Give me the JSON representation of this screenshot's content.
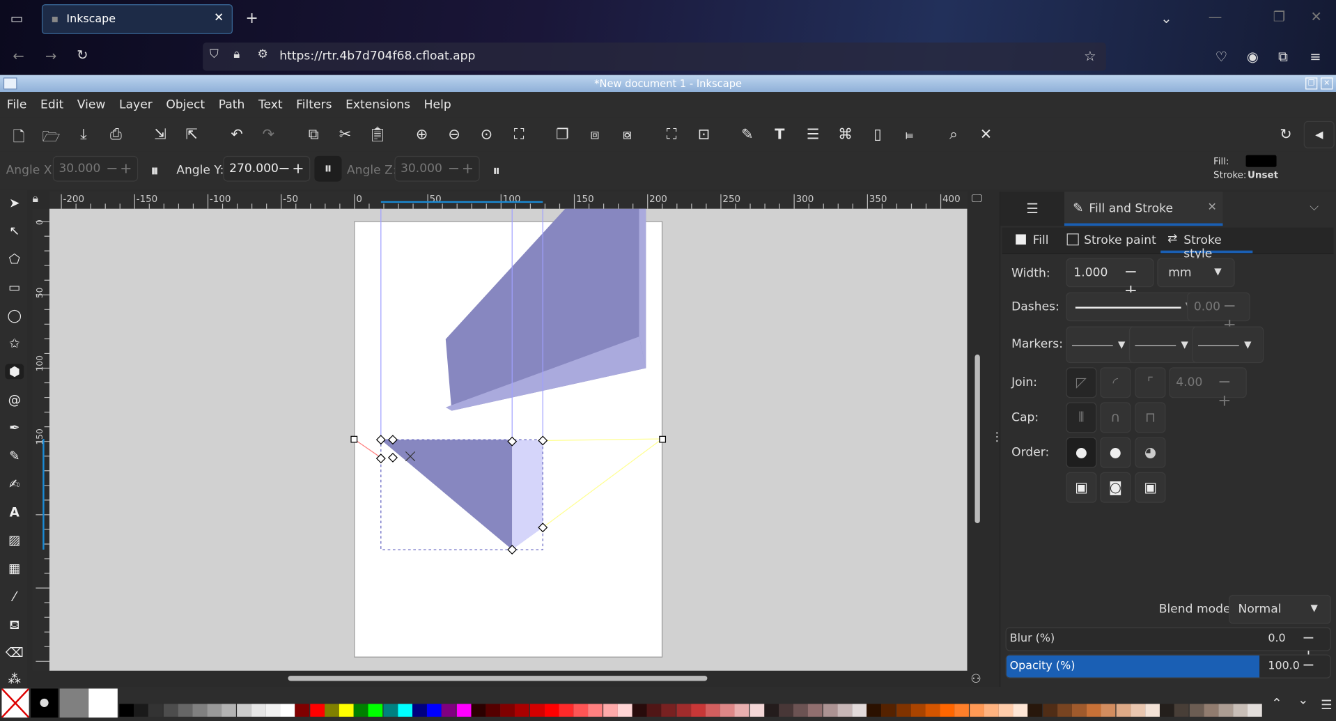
{
  "browser": {
    "tab_title": "Inkscape",
    "url": "https://rtr.4b7d704f68.cfloat.app"
  },
  "window": {
    "title": "*New document 1 - Inkscape"
  },
  "menu": [
    "File",
    "Edit",
    "View",
    "Layer",
    "Object",
    "Path",
    "Text",
    "Filters",
    "Extensions",
    "Help"
  ],
  "tool_controls": {
    "angle_x_label": "Angle X:",
    "angle_x": "30.000",
    "angle_y_label": "Angle Y:",
    "angle_y": "270.000",
    "angle_z_label": "Angle Z:",
    "angle_z": "30.000"
  },
  "style_indicator": {
    "fill_label": "Fill:",
    "stroke_label": "Stroke:",
    "stroke_value": "Unset",
    "fill_color": "#000000"
  },
  "ruler_labels": [
    "-200",
    "-150",
    "-100",
    "-50",
    "0",
    "50",
    "100",
    "150",
    "200",
    "250",
    "300",
    "350",
    "400"
  ],
  "vruler_labels": [
    "0",
    "50",
    "100",
    "150"
  ],
  "panel": {
    "tab_label": "Fill and Stroke",
    "subtabs": [
      "Fill",
      "Stroke paint",
      "Stroke style"
    ],
    "width_label": "Width:",
    "width_value": "1.000",
    "width_unit": "mm",
    "dashes_label": "Dashes:",
    "dash_offset": "0.00",
    "markers_label": "Markers:",
    "join_label": "Join:",
    "miter_limit": "4.00",
    "cap_label": "Cap:",
    "order_label": "Order:",
    "blend_label": "Blend mode:",
    "blend_value": "Normal",
    "blur_label": "Blur (%)",
    "blur_value": "0.0",
    "opacity_label": "Opacity (%)",
    "opacity_value": "100.0",
    "opacity_percent": 100,
    "accent_color": "#1a5fb4"
  },
  "palette": [
    "#000000",
    "#1a1a1a",
    "#333333",
    "#4d4d4d",
    "#666666",
    "#808080",
    "#999999",
    "#b3b3b3",
    "#cccccc",
    "#e6e6e6",
    "#f2f2f2",
    "#ffffff",
    "#800000",
    "#ff0000",
    "#808000",
    "#ffff00",
    "#008000",
    "#00ff00",
    "#008080",
    "#00ffff",
    "#000080",
    "#0000ff",
    "#800080",
    "#ff00ff",
    "#2b0000",
    "#550000",
    "#800000",
    "#aa0000",
    "#d40000",
    "#ff0000",
    "#ff2a2a",
    "#ff5555",
    "#ff8080",
    "#ffaaaa",
    "#ffd5d5",
    "#280b0b",
    "#501616",
    "#782121",
    "#a02c2c",
    "#c83737",
    "#d35f5f",
    "#de8787",
    "#e9afaf",
    "#f4d7d7",
    "#241c1c",
    "#483737",
    "#6c5353",
    "#916f6f",
    "#ac9393",
    "#c8b7b7",
    "#e3dbdb",
    "#2b1100",
    "#552200",
    "#803300",
    "#aa4400",
    "#d45500",
    "#ff6600",
    "#ff7f2a",
    "#ff9955",
    "#ffb380",
    "#ffccaa",
    "#ffe6d5",
    "#28170b",
    "#502d16",
    "#784421",
    "#a05a2c",
    "#c87137",
    "#d38d5f",
    "#deaa87",
    "#e9c6af",
    "#f4e3d7",
    "#241f1c",
    "#483e37",
    "#6c5d53",
    "#917c6f",
    "#ac9d93",
    "#c8beb7",
    "#e3dedb"
  ]
}
